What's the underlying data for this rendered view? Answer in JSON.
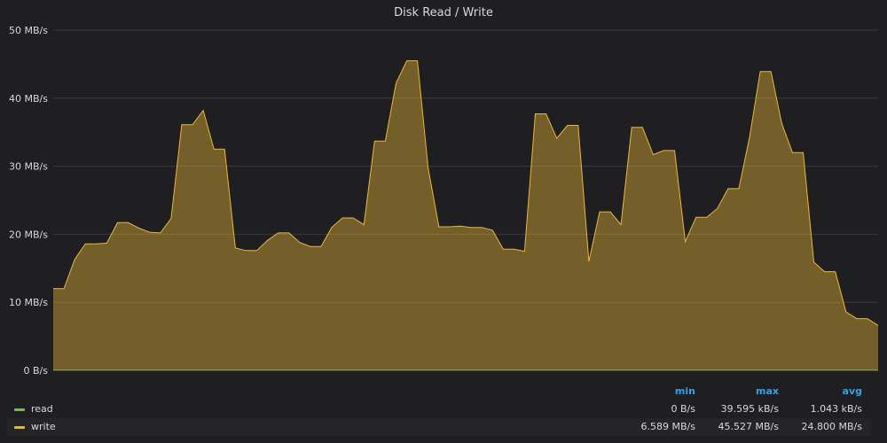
{
  "panel": {
    "title": "Disk Read / Write"
  },
  "chart_data": {
    "type": "area",
    "title": "Disk Read / Write",
    "ylim": [
      0,
      50
    ],
    "yunit": "MB/s",
    "yticks": [
      "0 B/s",
      "10 MB/s",
      "20 MB/s",
      "30 MB/s",
      "40 MB/s",
      "50 MB/s"
    ],
    "grid": true,
    "legend_placement": "bottom",
    "series": [
      {
        "name": "read",
        "color": "#7eb26d",
        "values": [
          0.04,
          0.04,
          0.04,
          0.04,
          0.04,
          0.04,
          0.04,
          0.04,
          0.04,
          0.04,
          0.04,
          0.04,
          0.04,
          0.04,
          0.04,
          0.04,
          0.04,
          0.04,
          0.04,
          0.04,
          0.04,
          0.04,
          0.04,
          0.04,
          0.04,
          0.04,
          0.04,
          0.04,
          0.04,
          0.04,
          0.04,
          0.04,
          0.04,
          0.04,
          0.04,
          0.04,
          0.04,
          0.04,
          0.04,
          0.04,
          0.04,
          0.04,
          0.04,
          0.04,
          0.04,
          0.04,
          0.04,
          0.04,
          0.04,
          0.04,
          0.04,
          0.04,
          0.04,
          0.04,
          0.04,
          0.04,
          0.04,
          0.04,
          0.04,
          0.04,
          0.04,
          0.04,
          0.04,
          0.04,
          0.04,
          0.04,
          0.04,
          0.04,
          0.04,
          0.04,
          0.04,
          0.04,
          0.04,
          0.04,
          0.04,
          0.04
        ]
      },
      {
        "name": "write",
        "color": "#eab839",
        "values": [
          12.0,
          12.0,
          16.3,
          18.6,
          18.6,
          18.7,
          21.7,
          21.7,
          20.9,
          20.3,
          20.2,
          22.3,
          36.1,
          36.1,
          38.2,
          32.5,
          32.5,
          18.0,
          17.6,
          17.6,
          19.1,
          20.2,
          20.2,
          18.8,
          18.2,
          18.2,
          21.0,
          22.4,
          22.4,
          21.4,
          33.7,
          33.7,
          42.2,
          45.5,
          45.5,
          29.7,
          21.1,
          21.1,
          21.2,
          21.0,
          21.0,
          20.6,
          17.8,
          17.8,
          17.5,
          37.7,
          37.7,
          34.1,
          36.0,
          36.0,
          16.0,
          23.3,
          23.3,
          21.4,
          35.7,
          35.7,
          31.7,
          32.3,
          32.3,
          18.9,
          22.5,
          22.5,
          23.8,
          26.7,
          26.7,
          34.3,
          43.9,
          43.9,
          36.3,
          32.0,
          32.0,
          15.9,
          14.5,
          14.5,
          8.6,
          7.6,
          7.6,
          6.6
        ]
      }
    ]
  },
  "legend": {
    "headers": {
      "min": "min",
      "max": "max",
      "avg": "avg"
    },
    "rows": [
      {
        "name": "read",
        "color": "#7eb26d",
        "min": "0 B/s",
        "max": "39.595 kB/s",
        "avg": "1.043 kB/s"
      },
      {
        "name": "write",
        "color": "#eab839",
        "min": "6.589 MB/s",
        "max": "45.527 MB/s",
        "avg": "24.800 MB/s"
      }
    ]
  }
}
